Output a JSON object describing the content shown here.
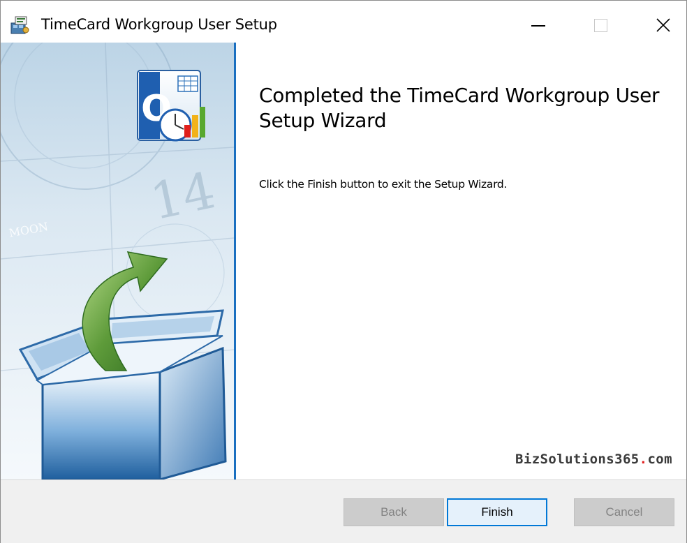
{
  "window": {
    "title": "TimeCard Workgroup User Setup",
    "app_icon": "installer-package-icon"
  },
  "title_buttons": {
    "minimize_icon": "minimize-icon",
    "maximize_icon": "maximize-icon",
    "close_icon": "close-icon"
  },
  "banner": {
    "calendar_text_moon": "MOON",
    "calendar_text_day": "14",
    "product_logo_icon": "timecard-logo-icon",
    "setup_box_icon": "open-box-arrow-icon"
  },
  "content": {
    "heading": "Completed the TimeCard Workgroup User Setup Wizard",
    "body": "Click the Finish button to exit the Setup Wizard."
  },
  "brand": {
    "name": "BizSolutions365",
    "dot": ".",
    "tld": "com"
  },
  "buttons": {
    "back": "Back",
    "finish": "Finish",
    "cancel": "Cancel"
  },
  "colors": {
    "divider": "#1a6fc0",
    "brand_dot": "#e02020",
    "finish_border": "#0078d7"
  }
}
